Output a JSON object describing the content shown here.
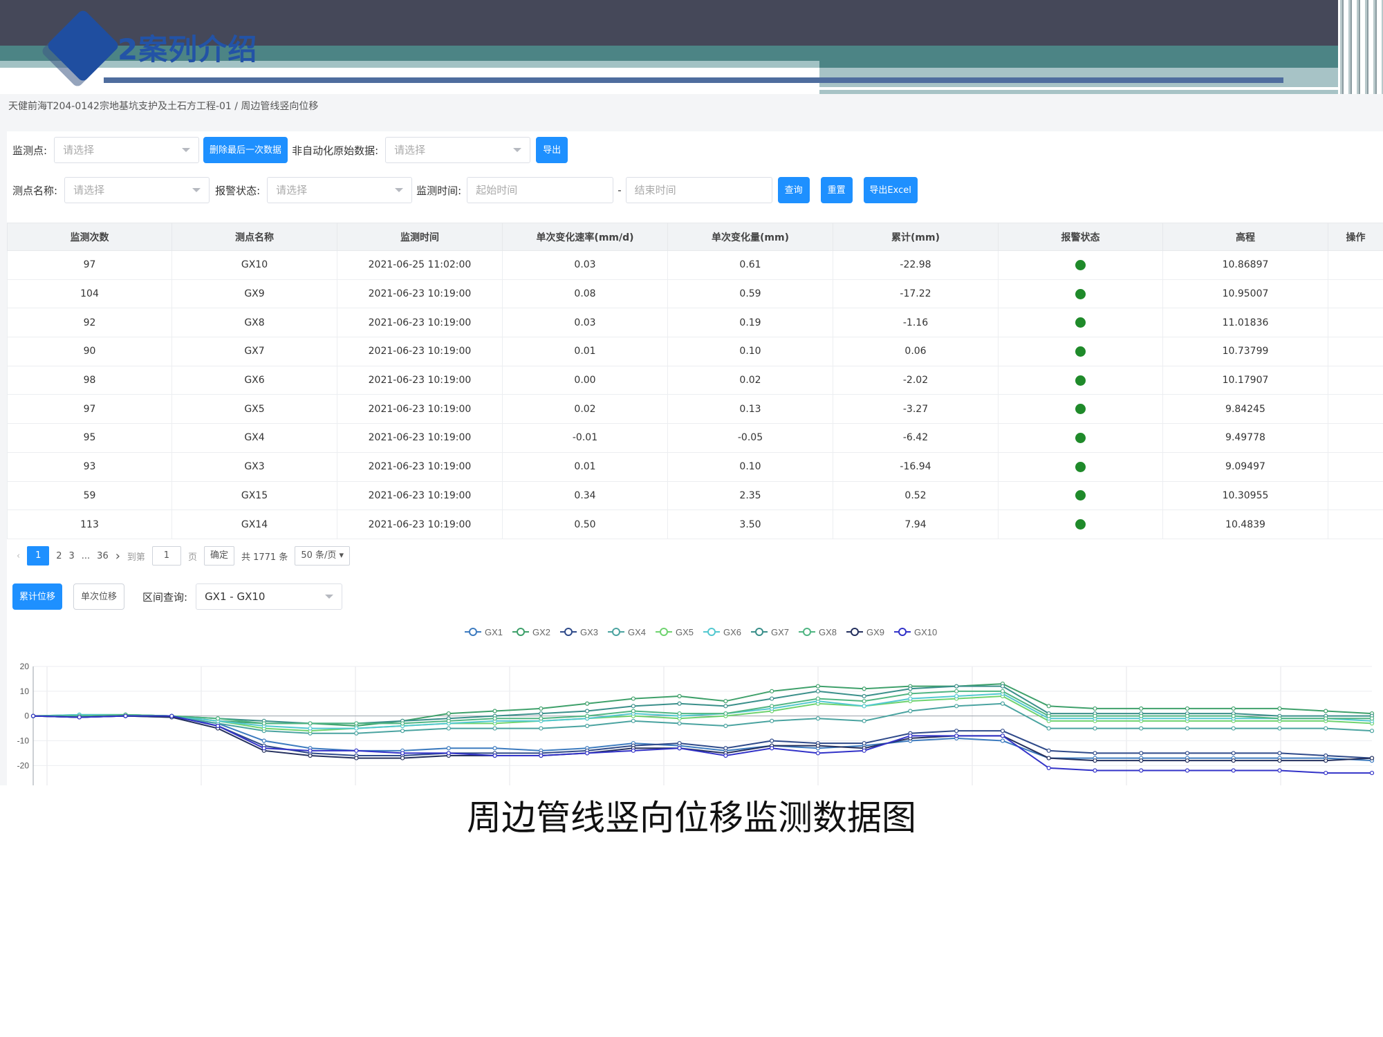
{
  "slide": {
    "title": "2案列介绍",
    "caption": "周边管线竖向位移监测数据图"
  },
  "breadcrumb": "天健前海T204-0142宗地基坑支护及土石方工程-01 / 周边管线竖向位移",
  "filters": {
    "monitor_point_label": "监测点:",
    "monitor_point_placeholder": "请选择",
    "delete_last_button": "删除最后一次数据",
    "raw_data_label": "非自动化原始数据:",
    "raw_data_placeholder": "请选择",
    "export_button": "导出",
    "point_name_label": "测点名称:",
    "point_name_placeholder": "请选择",
    "alarm_status_label": "报警状态:",
    "alarm_status_placeholder": "请选择",
    "monitor_time_label": "监测时间:",
    "start_time_placeholder": "起始时间",
    "time_separator": "-",
    "end_time_placeholder": "结束时间",
    "query_button": "查询",
    "reset_button": "重置",
    "export_excel_button": "导出Excel"
  },
  "table": {
    "columns": [
      "监测次数",
      "测点名称",
      "监测时间",
      "单次变化速率(mm/d)",
      "单次变化量(mm)",
      "累计(mm)",
      "报警状态",
      "高程",
      "操作"
    ],
    "rows": [
      [
        "97",
        "GX10",
        "2021-06-25 11:02:00",
        "0.03",
        "0.61",
        "-22.98",
        "normal",
        "10.86897",
        ""
      ],
      [
        "104",
        "GX9",
        "2021-06-23 10:19:00",
        "0.08",
        "0.59",
        "-17.22",
        "normal",
        "10.95007",
        ""
      ],
      [
        "92",
        "GX8",
        "2021-06-23 10:19:00",
        "0.03",
        "0.19",
        "-1.16",
        "normal",
        "11.01836",
        ""
      ],
      [
        "90",
        "GX7",
        "2021-06-23 10:19:00",
        "0.01",
        "0.10",
        "0.06",
        "normal",
        "10.73799",
        ""
      ],
      [
        "98",
        "GX6",
        "2021-06-23 10:19:00",
        "0.00",
        "0.02",
        "-2.02",
        "normal",
        "10.17907",
        ""
      ],
      [
        "97",
        "GX5",
        "2021-06-23 10:19:00",
        "0.02",
        "0.13",
        "-3.27",
        "normal",
        "9.84245",
        ""
      ],
      [
        "95",
        "GX4",
        "2021-06-23 10:19:00",
        "-0.01",
        "-0.05",
        "-6.42",
        "normal",
        "9.49778",
        ""
      ],
      [
        "93",
        "GX3",
        "2021-06-23 10:19:00",
        "0.01",
        "0.10",
        "-16.94",
        "normal",
        "9.09497",
        ""
      ],
      [
        "59",
        "GX15",
        "2021-06-23 10:19:00",
        "0.34",
        "2.35",
        "0.52",
        "normal",
        "10.30955",
        ""
      ],
      [
        "113",
        "GX14",
        "2021-06-23 10:19:00",
        "0.50",
        "3.50",
        "7.94",
        "normal",
        "10.4839",
        ""
      ]
    ],
    "alarm_color": "#1f8a2a"
  },
  "pagination": {
    "current": "1",
    "pages": [
      "2",
      "3"
    ],
    "ellipsis": "...",
    "last": "36",
    "goto_label": "到第",
    "goto_value": "1",
    "page_unit": "页",
    "confirm": "确定",
    "total": "共 1771 条",
    "page_size": "50 条/页"
  },
  "chart_controls": {
    "cumulative_button": "累计位移",
    "single_button": "单次位移",
    "range_label": "区间查询:",
    "range_value": "GX1 - GX10"
  },
  "chart_data": {
    "type": "line",
    "title": "",
    "xlabel": "",
    "ylabel": "",
    "ylim": [
      -28,
      20
    ],
    "yticks": [
      20,
      10,
      0,
      -10,
      -20
    ],
    "grid": true,
    "legend_position": "top",
    "x": [
      0,
      1,
      2,
      3,
      4,
      5,
      6,
      7,
      8,
      9,
      10,
      11,
      12,
      13,
      14,
      15,
      16,
      17,
      18,
      19,
      20,
      21,
      22,
      23,
      24,
      25,
      26,
      27,
      28,
      29
    ],
    "series": [
      {
        "name": "GX1",
        "color": "#3d7bbf",
        "values": [
          0,
          -0.5,
          0,
          -0.5,
          -3,
          -10,
          -13,
          -14,
          -14,
          -13,
          -13,
          -14,
          -13,
          -11,
          -12,
          -14,
          -12,
          -13,
          -12,
          -10,
          -9,
          -10,
          -17,
          -17,
          -17,
          -17,
          -17,
          -17,
          -17,
          -18
        ]
      },
      {
        "name": "GX2",
        "color": "#3ea06a",
        "values": [
          0,
          0.5,
          0.5,
          0,
          -2,
          -3,
          -3,
          -4,
          -2,
          1,
          2,
          3,
          5,
          7,
          8,
          6,
          10,
          12,
          11,
          12,
          12,
          13,
          4,
          3,
          3,
          3,
          3,
          3,
          2,
          1
        ]
      },
      {
        "name": "GX3",
        "color": "#2f4a8a",
        "values": [
          0,
          -0.5,
          0,
          0,
          -4,
          -12,
          -15,
          -16,
          -16,
          -15,
          -15,
          -15,
          -14,
          -12,
          -11,
          -13,
          -10,
          -11,
          -11,
          -7,
          -6,
          -6,
          -14,
          -15,
          -15,
          -15,
          -15,
          -15,
          -16,
          -17
        ]
      },
      {
        "name": "GX4",
        "color": "#4aa3a0",
        "values": [
          0,
          0,
          0.5,
          0,
          -3,
          -6,
          -7,
          -7,
          -6,
          -5,
          -5,
          -5,
          -4,
          -2,
          -3,
          -4,
          -2,
          -1,
          -2,
          2,
          4,
          5,
          -5,
          -5,
          -5,
          -5,
          -5,
          -5,
          -5,
          -6
        ]
      },
      {
        "name": "GX5",
        "color": "#6fd36f",
        "values": [
          0,
          0,
          0.5,
          0,
          -2,
          -5,
          -6,
          -5,
          -4,
          -3,
          -3,
          -2,
          -1,
          0,
          -1,
          0,
          2,
          5,
          4,
          6,
          7,
          8,
          -2,
          -2,
          -2,
          -2,
          -2,
          -2,
          -2,
          -3
        ]
      },
      {
        "name": "GX6",
        "color": "#53c8d0",
        "values": [
          0,
          0.5,
          0.5,
          0,
          -2,
          -4,
          -5,
          -5,
          -4,
          -3,
          -2,
          -2,
          -1,
          1,
          0,
          1,
          3,
          6,
          4,
          7,
          8,
          9,
          -1,
          -1,
          -1,
          -1,
          -1,
          -1,
          -1,
          -2
        ]
      },
      {
        "name": "GX7",
        "color": "#3a8f8a",
        "values": [
          0,
          0,
          0,
          0,
          -1,
          -2,
          -3,
          -3,
          -2,
          -1,
          0,
          1,
          2,
          4,
          5,
          4,
          7,
          10,
          8,
          11,
          12,
          12,
          1,
          1,
          1,
          1,
          1,
          0,
          0,
          0
        ]
      },
      {
        "name": "GX8",
        "color": "#4fb582",
        "values": [
          0,
          0,
          0.5,
          0,
          -1,
          -3,
          -3,
          -3,
          -3,
          -2,
          -1,
          -1,
          0,
          2,
          1,
          1,
          4,
          7,
          6,
          9,
          10,
          10,
          0,
          0,
          0,
          0,
          0,
          -1,
          -1,
          -1
        ]
      },
      {
        "name": "GX9",
        "color": "#24305e",
        "values": [
          0,
          -0.5,
          0,
          -0.5,
          -5,
          -14,
          -16,
          -17,
          -17,
          -16,
          -16,
          -16,
          -15,
          -13,
          -13,
          -15,
          -12,
          -12,
          -13,
          -9,
          -8,
          -8,
          -17,
          -18,
          -18,
          -18,
          -18,
          -18,
          -18,
          -17
        ]
      },
      {
        "name": "GX10",
        "color": "#3232c8",
        "values": [
          0,
          -0.5,
          0,
          0,
          -4,
          -13,
          -14,
          -14,
          -15,
          -15,
          -16,
          -16,
          -15,
          -14,
          -13,
          -16,
          -13,
          -15,
          -14,
          -8,
          -8,
          -8,
          -21,
          -22,
          -22,
          -22,
          -22,
          -22,
          -23,
          -23
        ]
      }
    ]
  }
}
